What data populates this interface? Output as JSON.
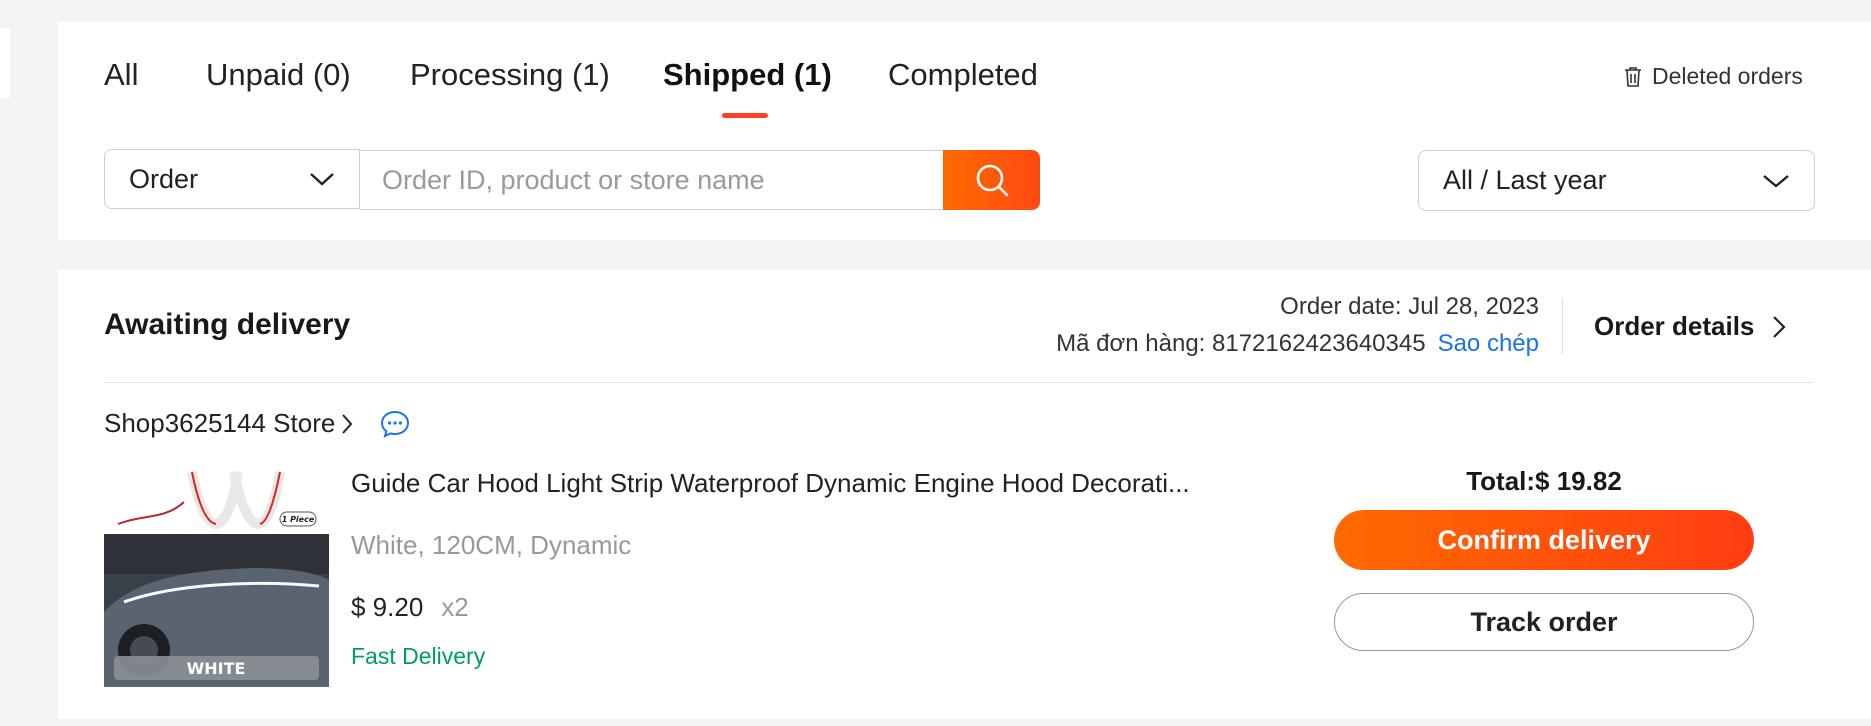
{
  "tabs": [
    {
      "label": "All"
    },
    {
      "label": "Unpaid (0)"
    },
    {
      "label": "Processing (1)"
    },
    {
      "label": "Shipped (1)"
    },
    {
      "label": "Completed"
    }
  ],
  "active_tab": "Shipped (1)",
  "deleted_orders": {
    "label": "Deleted orders",
    "icon": "trash-icon"
  },
  "search": {
    "scope_selected": "Order",
    "placeholder": "Order ID, product or store name",
    "button_icon": "search-icon"
  },
  "date_filter": {
    "selected": "All / Last year"
  },
  "order": {
    "status": "Awaiting delivery",
    "order_date": "Order date: Jul 28, 2023",
    "order_id_label": "Mã đơn hàng: 8172162423640345",
    "copy_label": "Sao chép",
    "details_label": "Order details",
    "store_name": "Shop3625144 Store",
    "product": {
      "title": "Guide Car Hood Light Strip Waterproof Dynamic Engine Hood Decorati...",
      "variant": "White, 120CM, Dynamic",
      "price": "$ 9.20",
      "quantity": "x2",
      "shipping_tag": "Fast Delivery",
      "image_text": {
        "badge": "1 Piece",
        "color": "WHITE"
      }
    },
    "total": "Total:$ 19.82",
    "confirm_label": "Confirm delivery",
    "track_label": "Track order"
  },
  "colors": {
    "accent": "#fd3f23",
    "orange": "#ff6a00",
    "link_blue": "#1a73e8",
    "success_green": "#00a05a"
  }
}
